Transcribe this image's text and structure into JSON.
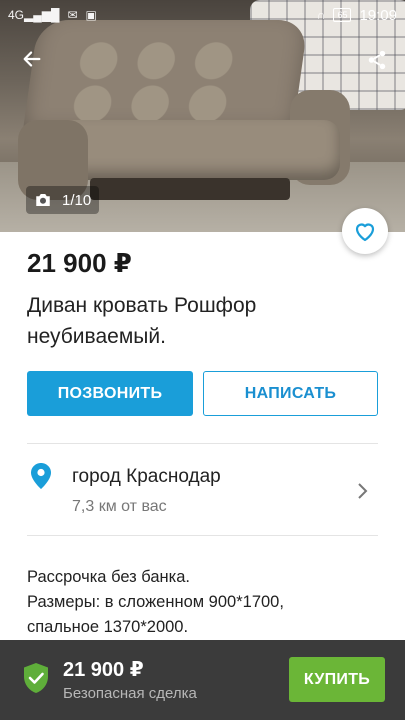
{
  "status_bar": {
    "network": "4G",
    "battery": "65",
    "time": "19:09"
  },
  "gallery": {
    "counter": "1/10"
  },
  "listing": {
    "price": "21 900 ₽",
    "title": "Диван кровать Рошфор неубиваемый."
  },
  "actions": {
    "call_label": "ПОЗВОНИТЬ",
    "write_label": "НАПИСАТЬ"
  },
  "location": {
    "city": "город Краснодар",
    "distance": "7,3 км от вас"
  },
  "description": {
    "line1": "Рассрочка без банка.",
    "line2": "Размеры: в сложенном 900*1700,",
    "line3": "спальное 1370*2000."
  },
  "bottom_bar": {
    "price": "21 900 ₽",
    "label": "Безопасная сделка",
    "buy_label": "КУПИТЬ"
  },
  "colors": {
    "primary_blue": "#1a9ed9",
    "buy_green": "#6bb637",
    "shield_green": "#5fae3a",
    "bottom_bar_bg": "#3b3b3b"
  },
  "icons": [
    "back-arrow-icon",
    "share-icon",
    "camera-icon",
    "heart-icon",
    "location-pin-icon",
    "chevron-right-icon",
    "shield-check-icon"
  ]
}
